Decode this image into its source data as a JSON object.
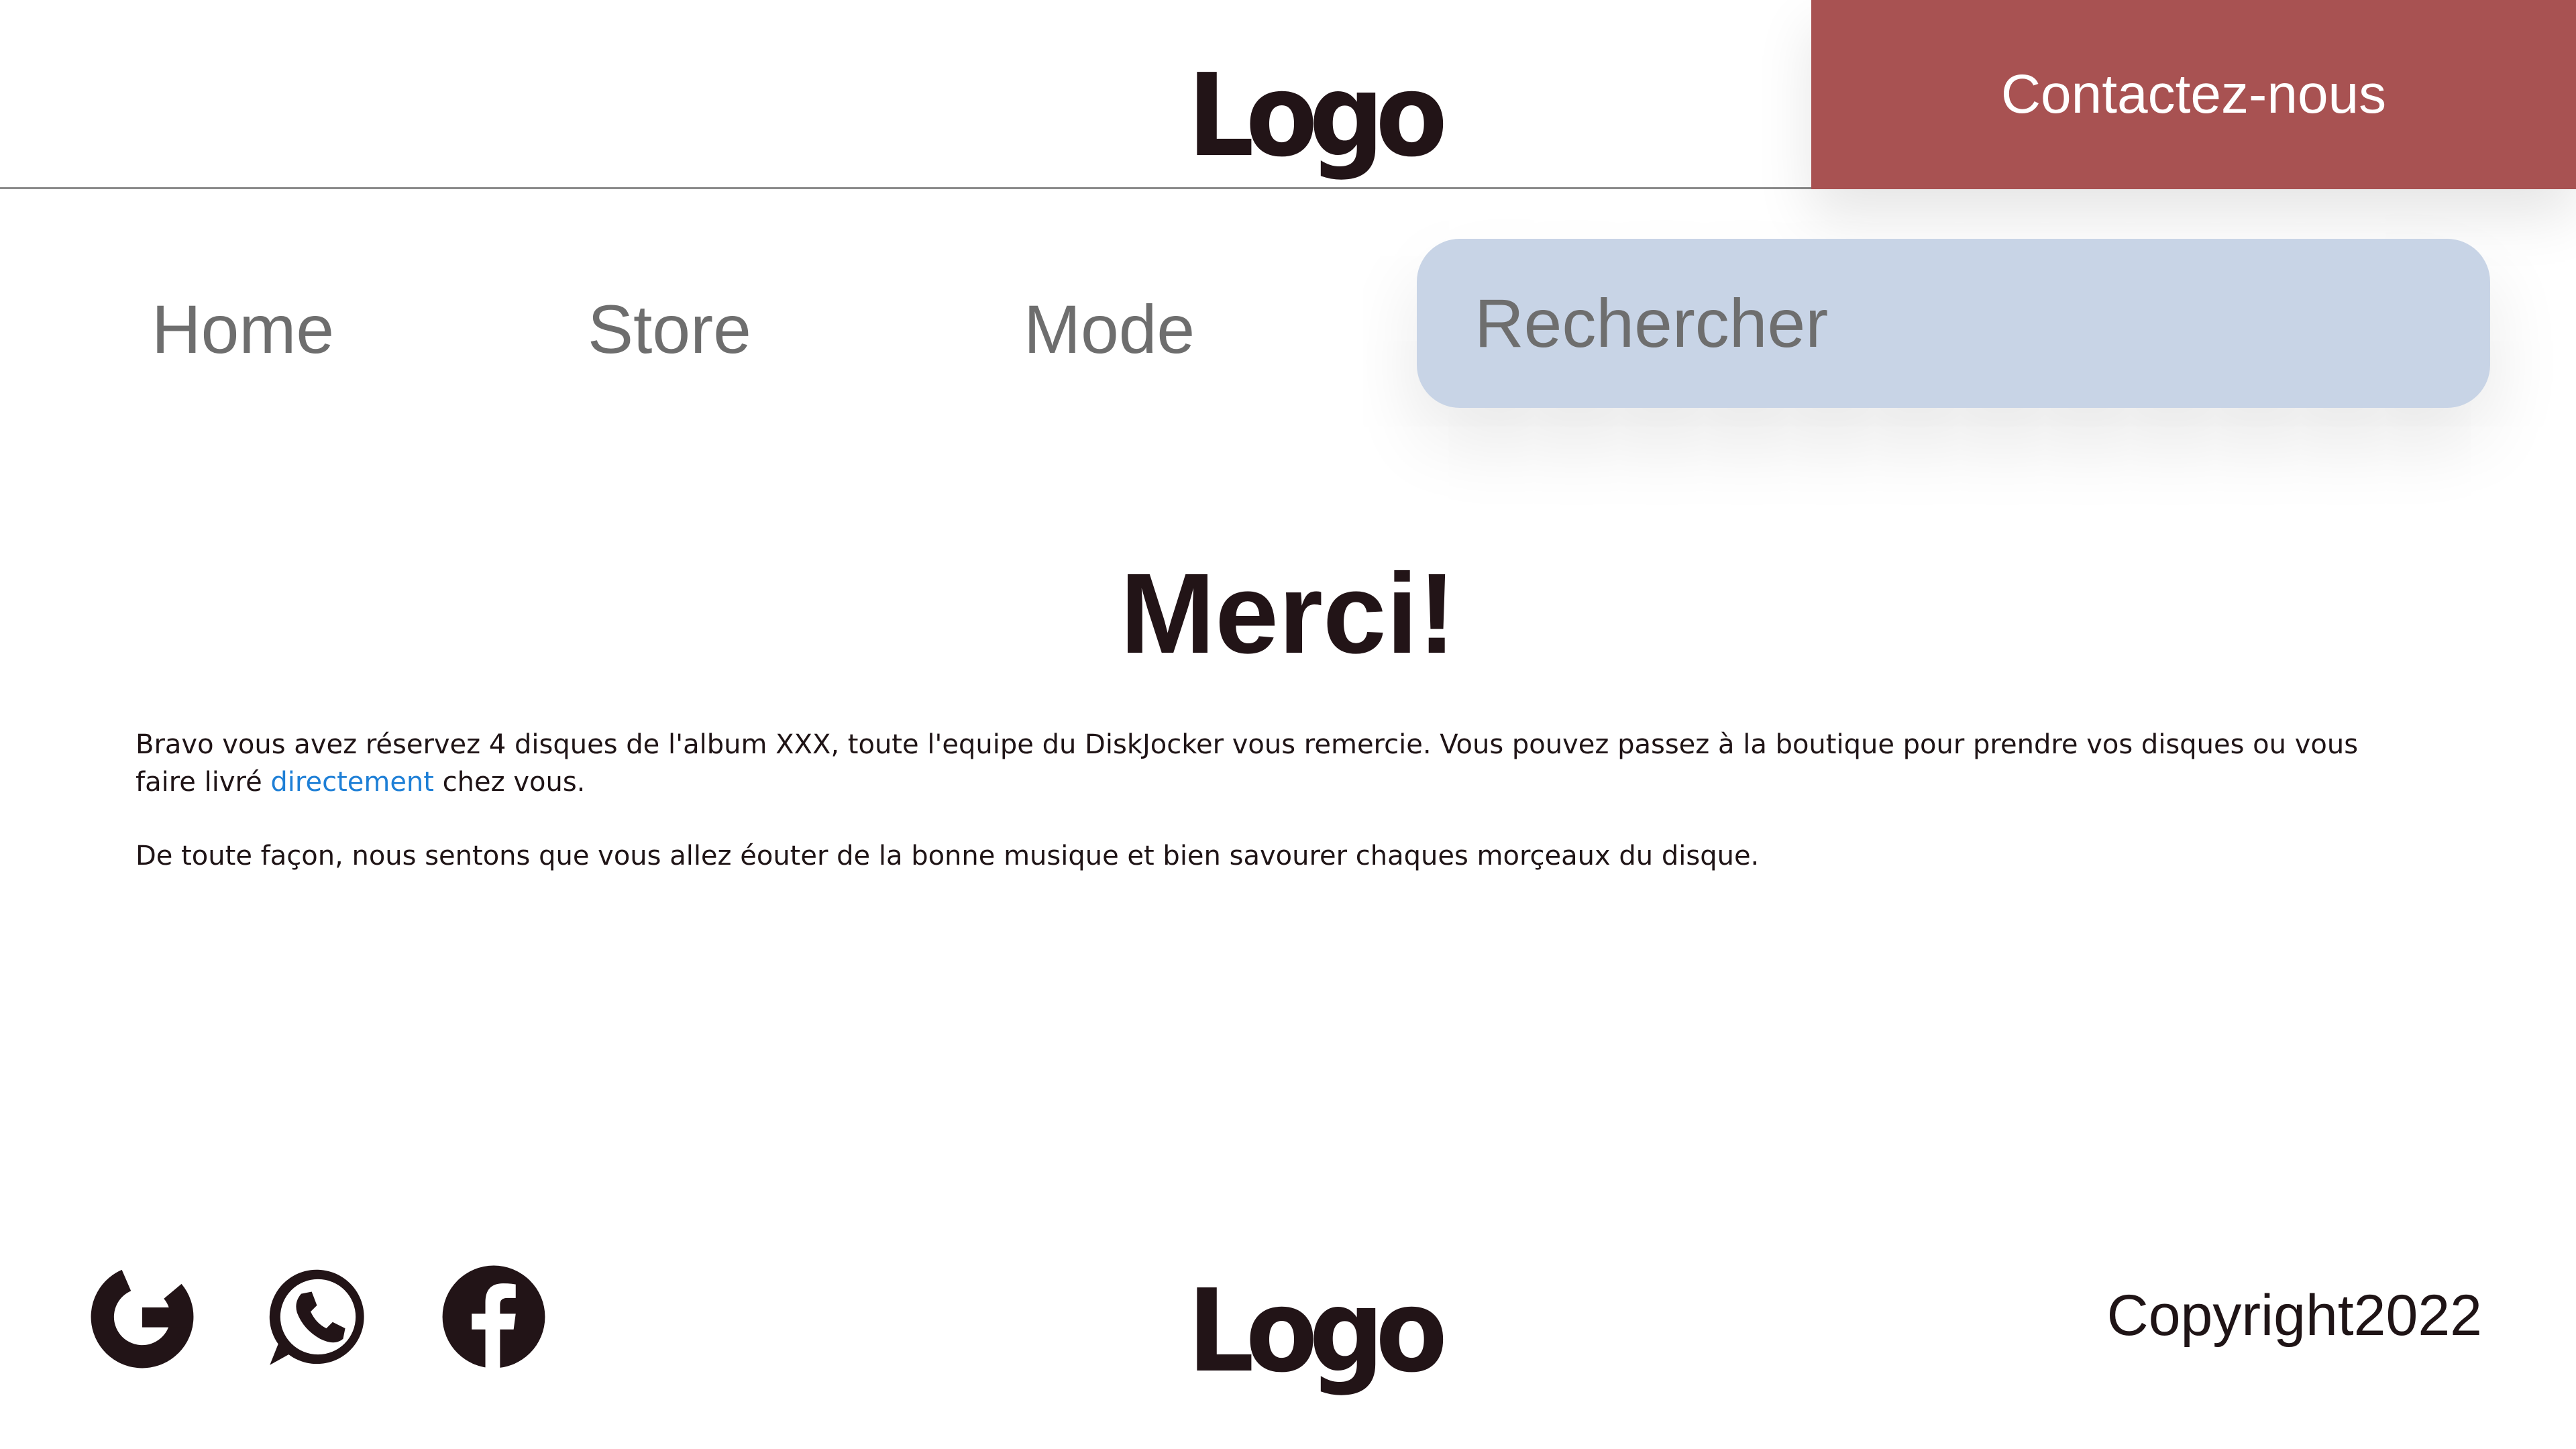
{
  "header": {
    "logo_text": "Logo",
    "contact_label": "Contactez-nous"
  },
  "nav": {
    "items": [
      {
        "label": "Home"
      },
      {
        "label": "Store"
      },
      {
        "label": "Mode"
      }
    ],
    "search_placeholder": "Rechercher"
  },
  "main": {
    "title": "Merci!",
    "paragraph1_text": "Bravo vous avez réservez 4 disques de l'album XXX, toute l'equipe du DiskJocker vous remercie. Vous pouvez passez à la boutique pour prendre vos disques ou vous faire livré ",
    "paragraph1_link": "directement",
    "paragraph1_end": " chez vous.",
    "paragraph2_text": "De toute façon, nous sentons que vous allez éouter de la bonne musique et bien savourer chaques morçeaux du disque."
  },
  "footer": {
    "social_icons": [
      "google-icon",
      "whatsapp-icon",
      "facebook-icon"
    ],
    "logo_text": "Logo",
    "copyright": "Copyright2022"
  },
  "colors": {
    "contact_bg": "#a85252",
    "search_bg": "#c8d4e6",
    "link": "#1e7fd6",
    "text_dark": "#221417",
    "nav_text": "#6e6e6e"
  }
}
